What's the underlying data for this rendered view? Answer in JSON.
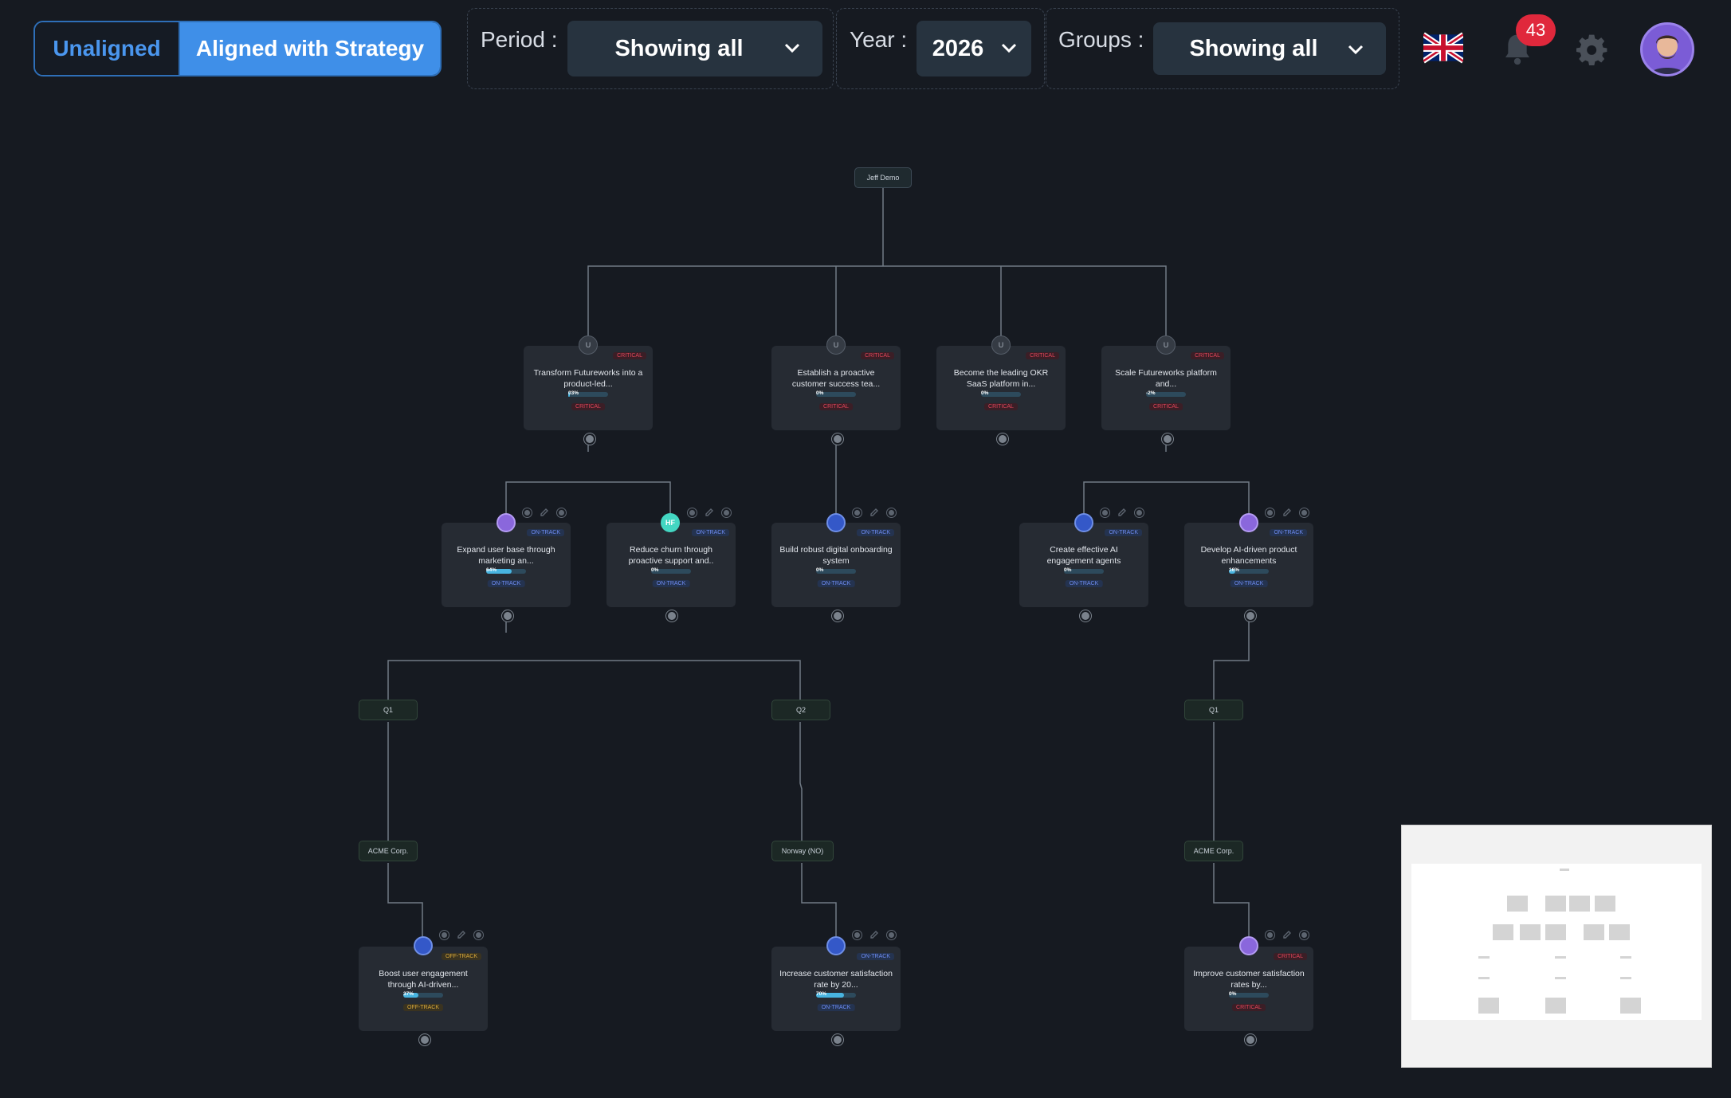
{
  "toolbar": {
    "unaligned_label": "Unaligned",
    "aligned_label": "Aligned with Strategy",
    "period_label": "Period :",
    "period_value": "Showing all",
    "year_label": "Year :",
    "year_value": "2026",
    "groups_label": "Groups :",
    "groups_value": "Showing all",
    "notification_count": "43",
    "language_icon": "uk-flag-icon",
    "notification_icon": "bell-icon",
    "settings_icon": "gear-icon"
  },
  "colors": {
    "background": "#161a21",
    "accent": "#3f8fe8",
    "critical": "#e2465a",
    "on_track": "#6e8cf2",
    "off_track": "#d8a83a"
  },
  "tree": {
    "root": "Jeff Demo",
    "objectives": [
      {
        "owner": "U",
        "title": "Transform Futureworks into a product-led...",
        "progress": 0.03,
        "progress_label": "03%",
        "status": "CRITICAL"
      },
      {
        "owner": "U",
        "title": "Establish a proactive customer success tea...",
        "progress": 0.0,
        "progress_label": "0%",
        "status": "CRITICAL"
      },
      {
        "owner": "U",
        "title": "Become the leading OKR SaaS platform in...",
        "progress": 0.0,
        "progress_label": "0%",
        "status": "CRITICAL"
      },
      {
        "owner": "U",
        "title": "Scale Futureworks platform and...",
        "progress": 0.0,
        "progress_label": "-2%",
        "status": "CRITICAL"
      }
    ],
    "key_results": [
      {
        "owner": "photo",
        "title": "Expand user base through marketing an...",
        "progress": 0.64,
        "progress_label": "64%",
        "status": "ON-TRACK"
      },
      {
        "owner": "HF",
        "title": "Reduce churn through proactive support and..",
        "progress": 0.0,
        "progress_label": "0%",
        "status": "ON-TRACK"
      },
      {
        "owner": "photo",
        "title": "Build robust digital onboarding system",
        "progress": 0.0,
        "progress_label": "0%",
        "status": "ON-TRACK"
      },
      {
        "owner": "photo",
        "title": "Create effective AI engagement agents",
        "progress": 0.0,
        "progress_label": "0%",
        "status": "ON-TRACK"
      },
      {
        "owner": "photo",
        "title": "Develop AI-driven product enhancements",
        "progress": 0.16,
        "progress_label": "16%",
        "status": "ON-TRACK"
      }
    ],
    "periods": [
      "Q1",
      "Q2",
      "Q1"
    ],
    "groups": [
      "ACME Corp.",
      "Norway (NO)",
      "ACME Corp."
    ],
    "initiatives": [
      {
        "owner": "photo",
        "title": "Boost user engagement through AI-driven...",
        "progress": 0.37,
        "progress_label": "37%",
        "status": "OFF-TRACK"
      },
      {
        "owner": "photo",
        "title": "Increase customer satisfaction rate by 20...",
        "progress": 0.7,
        "progress_label": "70%",
        "status": "ON-TRACK"
      },
      {
        "owner": "photo",
        "title": "Improve customer satisfaction rates by...",
        "progress": 0.0,
        "progress_label": "0%",
        "status": "CRITICAL"
      }
    ]
  }
}
